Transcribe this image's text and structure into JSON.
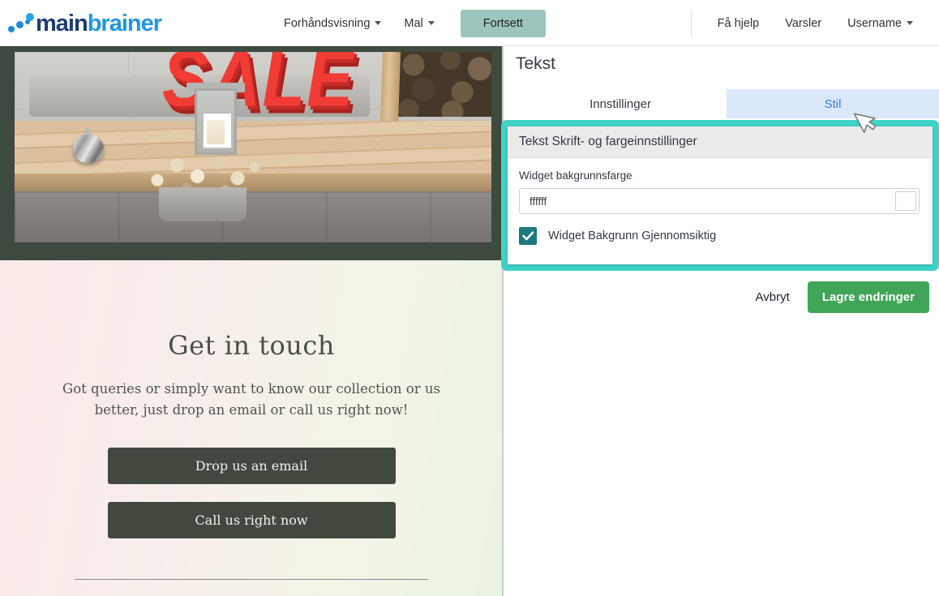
{
  "nav": {
    "logo": {
      "part1": "main",
      "part2": "brainer",
      "icon": "logo-dots-icon"
    },
    "center": [
      {
        "label": "Forhåndsvisning",
        "has_caret": true
      },
      {
        "label": "Mal",
        "has_caret": true
      }
    ],
    "primary_button": "Fortsett",
    "right": [
      {
        "label": "Få hjelp",
        "has_caret": false
      },
      {
        "label": "Varsler",
        "has_caret": false
      },
      {
        "label": "Username",
        "has_caret": true
      }
    ]
  },
  "preview": {
    "photo_alt": "SALE sign on wooden deck with lantern and silver pot",
    "sale_text": "SALE",
    "heading": "Get in touch",
    "body": "Got queries or simply want to know our collection or us better, just drop an email or call us right now!",
    "buttons": [
      {
        "label": "Drop us an email"
      },
      {
        "label": "Call us right now"
      }
    ]
  },
  "panel": {
    "title": "Tekst",
    "tabs": [
      {
        "label": "Innstillinger",
        "active": false
      },
      {
        "label": "Stil",
        "active": true
      }
    ],
    "card": {
      "header": "Tekst Skrift- og fargeinnstillinger",
      "color_field_label": "Widget bakgrunnsfarge",
      "color_value": "ffffff",
      "color_placeholder": "ffffff",
      "swatch_color": "#ffffff",
      "checkbox_label": "Widget Bakgrunn Gjennomsiktig",
      "checkbox_checked": true
    },
    "actions": {
      "cancel": "Avbryt",
      "save": "Lagre endringer"
    }
  },
  "colors": {
    "highlight_border": "#3fd3c6",
    "save_green": "#40a557",
    "active_tab_bg": "#d9e9fb",
    "active_tab_text": "#2979ff",
    "checkbox_teal": "#1a7a7e",
    "fortsett_bg": "#9cc5bd",
    "preview_button_bg": "#41493f"
  }
}
